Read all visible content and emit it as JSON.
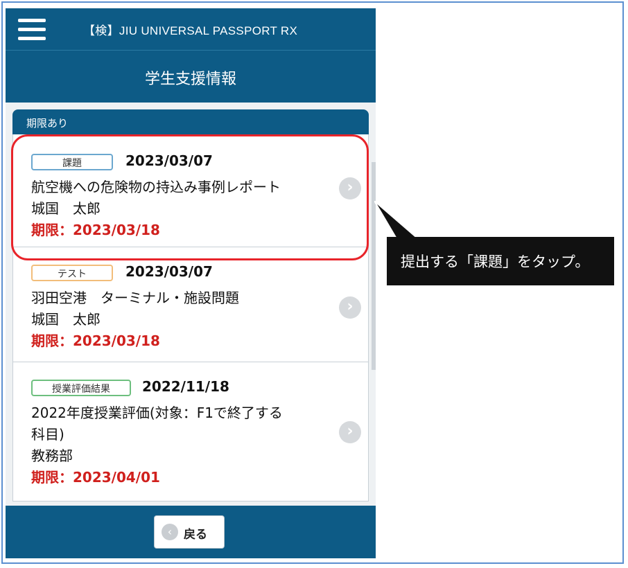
{
  "app": {
    "title": "【検】JIU UNIVERSAL PASSPORT RX"
  },
  "page": {
    "title": "学生支援情報"
  },
  "section": {
    "header": "期限あり"
  },
  "items": [
    {
      "tag": "課題",
      "date": "2023/03/07",
      "title_lines": [
        "航空機への危険物の持込み事例レポート"
      ],
      "person": "城国　太郎",
      "deadline": "期限：2023/03/18"
    },
    {
      "tag": "テスト",
      "date": "2023/03/07",
      "title_lines": [
        "羽田空港　ターミナル・施設問題"
      ],
      "person": "城国　太郎",
      "deadline": "期限：2023/03/18"
    },
    {
      "tag": "授業評価結果",
      "date": "2022/11/18",
      "title_lines": [
        "2022年度授業評価(対象：F1で終了する",
        "科目)"
      ],
      "person": "教務部",
      "deadline": "期限：2023/04/01"
    }
  ],
  "icons": {
    "menu": "menu-icon",
    "chevron": "chevron-right-icon",
    "back": "back-arrow-icon"
  },
  "footer": {
    "back_label": "戻る"
  },
  "callout": {
    "text": "提出する「課題」をタップ。"
  },
  "colors": {
    "primary": "#0d5b86",
    "deadline": "#d0201d",
    "highlight": "#e8242a",
    "callout_bg": "#111111"
  }
}
